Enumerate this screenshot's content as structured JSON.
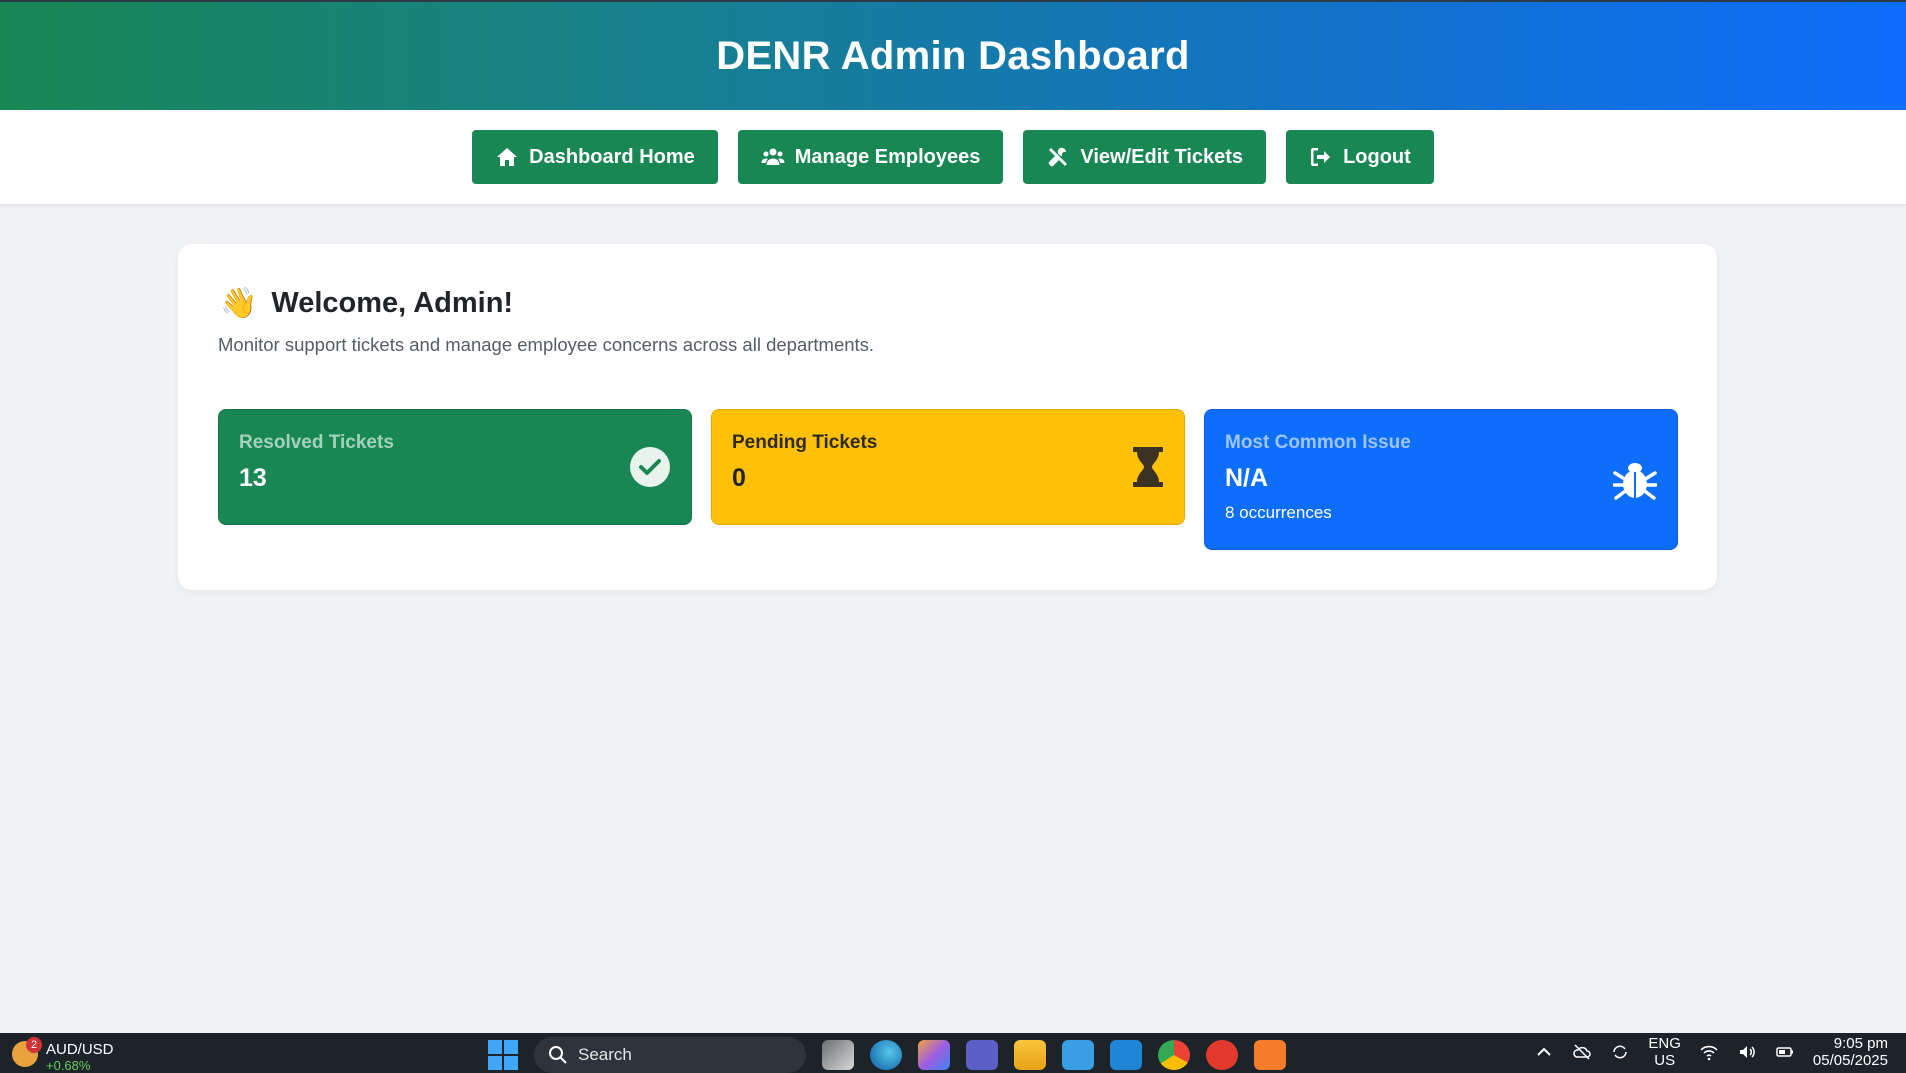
{
  "header": {
    "title": "DENR Admin Dashboard"
  },
  "nav": {
    "items": [
      {
        "label": "Dashboard Home",
        "icon": "home-icon"
      },
      {
        "label": "Manage Employees",
        "icon": "users-icon"
      },
      {
        "label": "View/Edit Tickets",
        "icon": "tools-icon"
      },
      {
        "label": "Logout",
        "icon": "logout-icon"
      }
    ]
  },
  "welcome": {
    "emoji": "👋",
    "title": "Welcome, Admin!",
    "subtitle": "Monitor support tickets and manage employee concerns across all departments."
  },
  "stats": {
    "resolved": {
      "label": "Resolved Tickets",
      "value": "13",
      "icon": "check-circle-icon",
      "color": "#198754"
    },
    "pending": {
      "label": "Pending Tickets",
      "value": "0",
      "icon": "hourglass-icon",
      "color": "#ffc107"
    },
    "common": {
      "label": "Most Common Issue",
      "value": "N/A",
      "extra": "8 occurrences",
      "icon": "bug-icon",
      "color": "#0d6efd"
    }
  },
  "taskbar": {
    "widget": {
      "badge": "2",
      "pair": "AUD/USD",
      "change": "+0.68%"
    },
    "search_placeholder": "Search",
    "lang_top": "ENG",
    "lang_bottom": "US",
    "time": "9:05 pm",
    "date": "05/05/2025"
  }
}
